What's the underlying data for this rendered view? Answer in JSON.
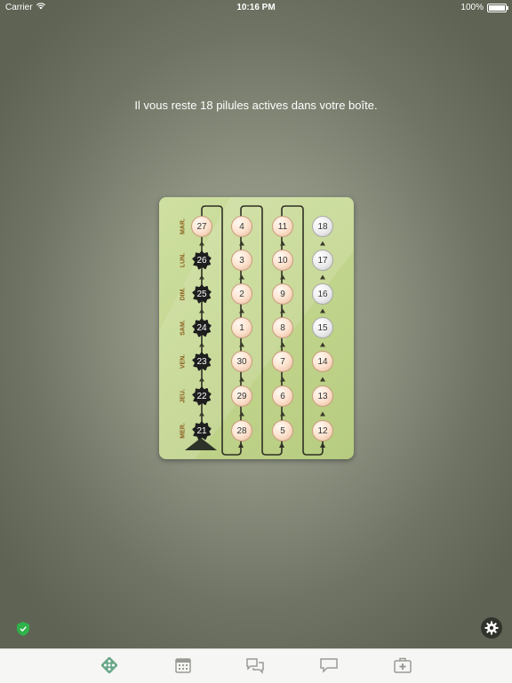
{
  "status_bar": {
    "carrier": "Carrier",
    "time": "10:16 PM",
    "battery": "100%"
  },
  "message": "Il vous reste 18 pilules actives dans votre boîte.",
  "blister": {
    "day_labels": [
      "MAR.",
      "LUN.",
      "DIM.",
      "SAM.",
      "VEN.",
      "JEU.",
      "MER."
    ],
    "columns": [
      {
        "pills": [
          {
            "number": "27",
            "state": "active"
          },
          {
            "number": "26",
            "state": "taken"
          },
          {
            "number": "25",
            "state": "taken"
          },
          {
            "number": "24",
            "state": "taken"
          },
          {
            "number": "23",
            "state": "taken"
          },
          {
            "number": "22",
            "state": "taken"
          },
          {
            "number": "21",
            "state": "taken"
          }
        ]
      },
      {
        "pills": [
          {
            "number": "4",
            "state": "active"
          },
          {
            "number": "3",
            "state": "active"
          },
          {
            "number": "2",
            "state": "active"
          },
          {
            "number": "1",
            "state": "active"
          },
          {
            "number": "30",
            "state": "active"
          },
          {
            "number": "29",
            "state": "active"
          },
          {
            "number": "28",
            "state": "active"
          }
        ]
      },
      {
        "pills": [
          {
            "number": "11",
            "state": "active"
          },
          {
            "number": "10",
            "state": "active"
          },
          {
            "number": "9",
            "state": "active"
          },
          {
            "number": "8",
            "state": "active"
          },
          {
            "number": "7",
            "state": "active"
          },
          {
            "number": "6",
            "state": "active"
          },
          {
            "number": "5",
            "state": "active"
          }
        ]
      },
      {
        "pills": [
          {
            "number": "18",
            "state": "placebo"
          },
          {
            "number": "17",
            "state": "placebo"
          },
          {
            "number": "16",
            "state": "placebo"
          },
          {
            "number": "15",
            "state": "placebo"
          },
          {
            "number": "14",
            "state": "active"
          },
          {
            "number": "13",
            "state": "active"
          },
          {
            "number": "12",
            "state": "active"
          }
        ]
      }
    ]
  },
  "icons": {
    "shield": "shield-icon",
    "settings": "gear-icon"
  },
  "tabs": [
    {
      "icon": "pill-pack-icon",
      "active": true
    },
    {
      "icon": "calendar-icon",
      "active": false
    },
    {
      "icon": "chat-bubbles-icon",
      "active": false
    },
    {
      "icon": "comment-icon",
      "active": false
    },
    {
      "icon": "medical-kit-icon",
      "active": false
    }
  ],
  "colors": {
    "accent": "#6aa889",
    "pill_active": "#fde3cf",
    "pill_placebo": "#ebebeb",
    "pill_taken": "#1e1e1e",
    "label": "#8a5e1c",
    "shield": "#2fb24a"
  }
}
